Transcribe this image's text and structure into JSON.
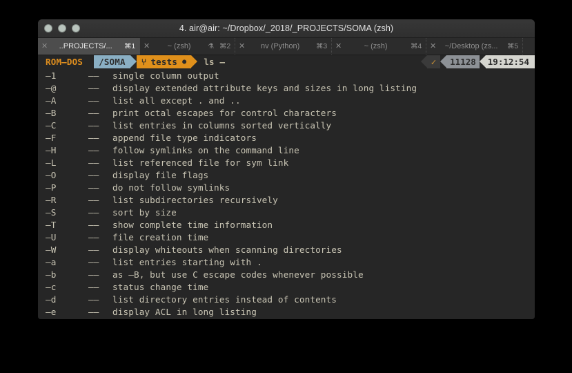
{
  "window": {
    "title": "4. air@air: ~/Dropbox/_2018/_PROJECTS/SOMA (zsh)",
    "controls": {
      "close": "close-button",
      "minimize": "minimize-button",
      "zoom": "zoom-button"
    }
  },
  "tabs": [
    {
      "close": "✕",
      "label": "..PROJECTS/...",
      "key": "⌘1",
      "bell": "",
      "active": true
    },
    {
      "close": "✕",
      "label": "~ (zsh)",
      "key": "⌘2",
      "bell": "⚗",
      "active": false
    },
    {
      "close": "✕",
      "label": "nv (Python)",
      "key": "⌘3",
      "bell": "",
      "active": false
    },
    {
      "close": "✕",
      "label": "~ (zsh)",
      "key": "⌘4",
      "bell": "",
      "active": false
    },
    {
      "close": "✕",
      "label": "~/Desktop (zs...",
      "key": "⌘5",
      "bell": "",
      "active": false
    }
  ],
  "prompt": {
    "user_segment": "ROM—DOS",
    "path_segment": "/SOMA",
    "git_icon": "⑂",
    "git_branch": "tests",
    "git_dirty": "●",
    "command": "ls —",
    "right": {
      "status_icon": "✓",
      "count": "11128",
      "clock": "19:12:54"
    },
    "colors": {
      "user_fg": "#e08f1e",
      "path_bg": "#8aafc4",
      "git_bg": "#e0901b",
      "count_bg": "#8d9196",
      "clock_bg": "#d5d5cf",
      "status_fg": "#c08a35"
    }
  },
  "output": {
    "dash": "——",
    "lines": [
      {
        "flag": "—1",
        "desc": "single column output"
      },
      {
        "flag": "—@",
        "desc": "display extended attribute keys and sizes in long listing"
      },
      {
        "flag": "—A",
        "desc": "list all except . and .."
      },
      {
        "flag": "—B",
        "desc": "print octal escapes for control characters"
      },
      {
        "flag": "—C",
        "desc": "list entries in columns sorted vertically"
      },
      {
        "flag": "—F",
        "desc": "append file type indicators"
      },
      {
        "flag": "—H",
        "desc": "follow symlinks on the command line"
      },
      {
        "flag": "—L",
        "desc": "list referenced file for sym link"
      },
      {
        "flag": "—O",
        "desc": "display file flags"
      },
      {
        "flag": "—P",
        "desc": "do not follow symlinks"
      },
      {
        "flag": "—R",
        "desc": "list subdirectories recursively"
      },
      {
        "flag": "—S",
        "desc": "sort by size"
      },
      {
        "flag": "—T",
        "desc": "show complete time information"
      },
      {
        "flag": "—U",
        "desc": "file creation time"
      },
      {
        "flag": "—W",
        "desc": "display whiteouts when scanning directories"
      },
      {
        "flag": "—a",
        "desc": "list entries starting with ."
      },
      {
        "flag": "—b",
        "desc": "as —B, but use C escape codes whenever possible"
      },
      {
        "flag": "—c",
        "desc": "status change time"
      },
      {
        "flag": "—d",
        "desc": "list directory entries instead of contents"
      },
      {
        "flag": "—e",
        "desc": "display ACL in long listing"
      }
    ]
  }
}
